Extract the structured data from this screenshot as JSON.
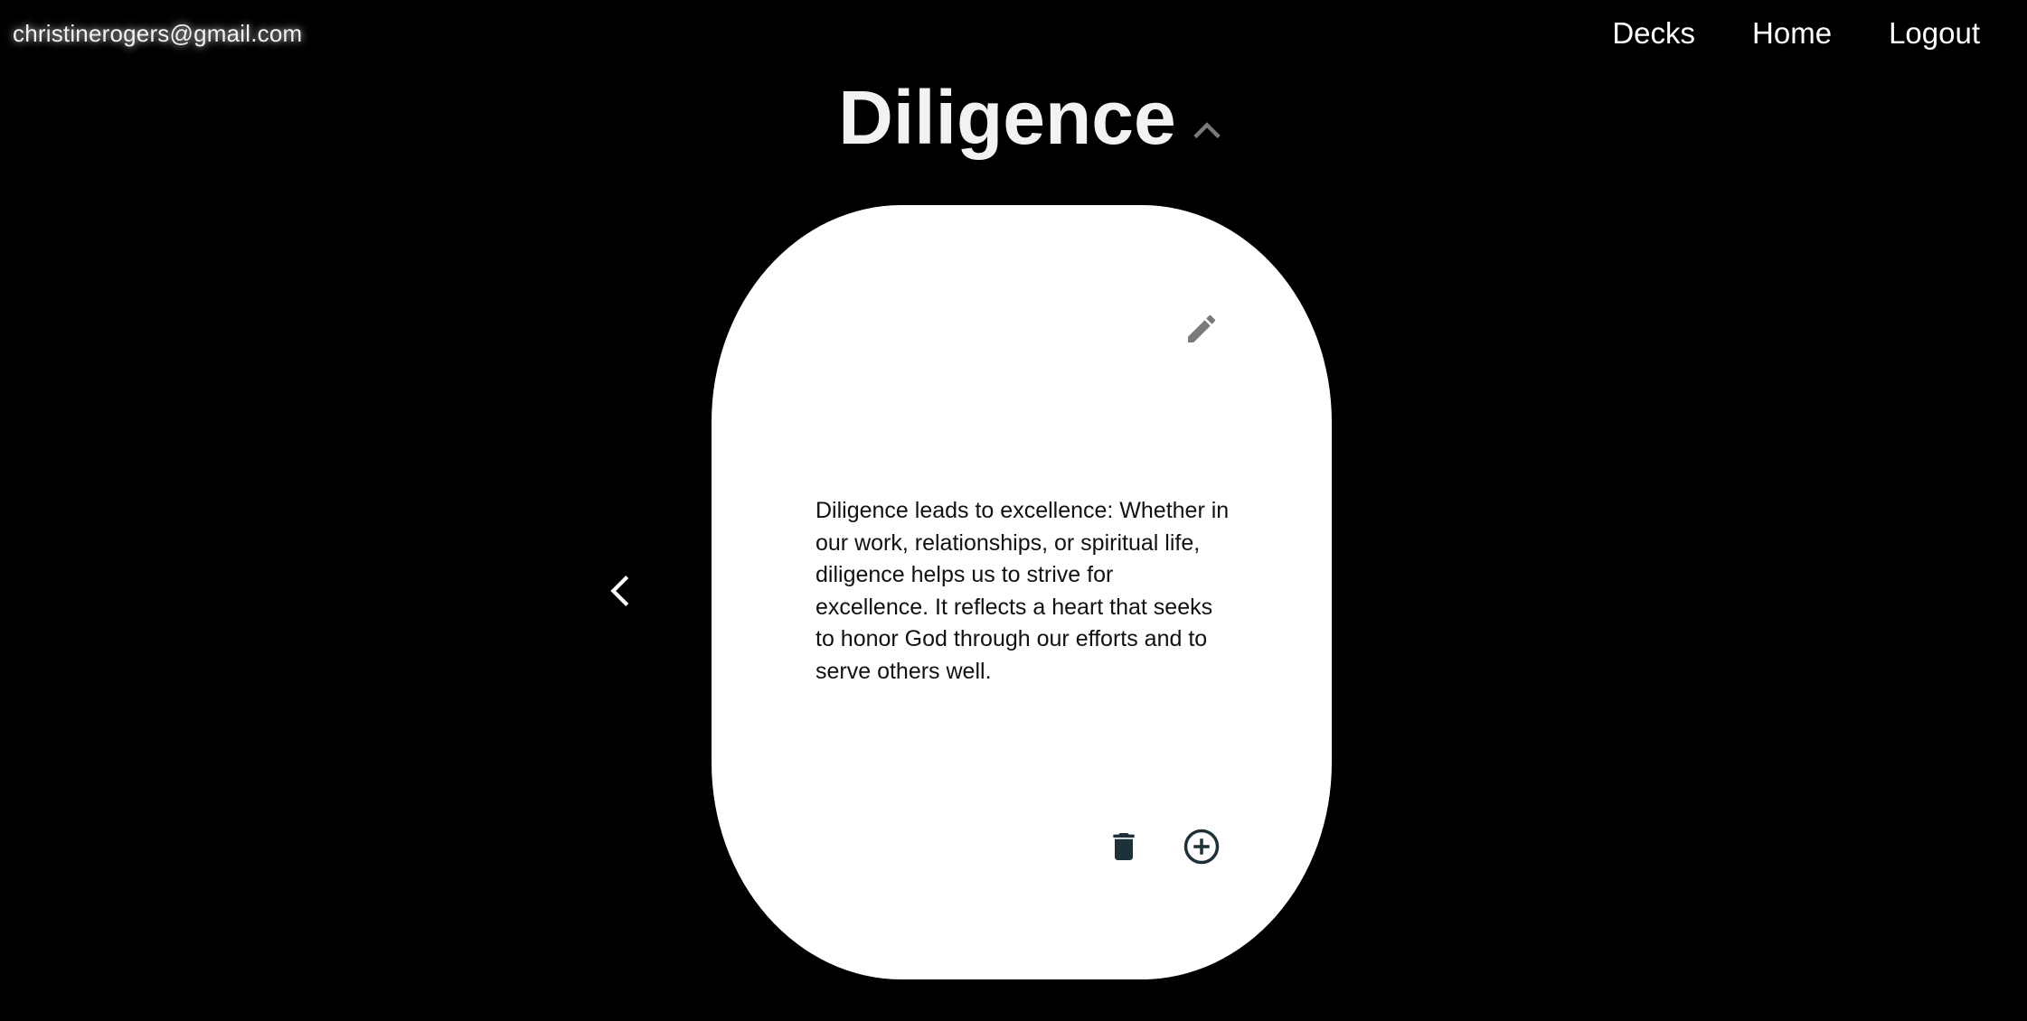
{
  "header": {
    "user_email": "christinerogers@gmail.com",
    "nav": [
      {
        "label": "Decks"
      },
      {
        "label": "Home"
      },
      {
        "label": "Logout"
      }
    ]
  },
  "deck": {
    "title": "Diligence",
    "title_toggle_icon": "chevron-up-icon"
  },
  "card": {
    "text": "Diligence leads to excellence: Whether in our work, relationships, or spiritual life, diligence helps us to strive for excellence. It reflects a heart that seeks to honor God through our efforts and to serve others well.",
    "edit_icon": "pencil-icon",
    "delete_icon": "trash-icon",
    "add_icon": "plus-circle-icon"
  },
  "navigation": {
    "prev_icon": "chevron-left-icon"
  },
  "colors": {
    "background": "#000000",
    "card": "#ffffff",
    "action_icon": "#1f3138",
    "muted_icon": "#7a7a7a"
  }
}
